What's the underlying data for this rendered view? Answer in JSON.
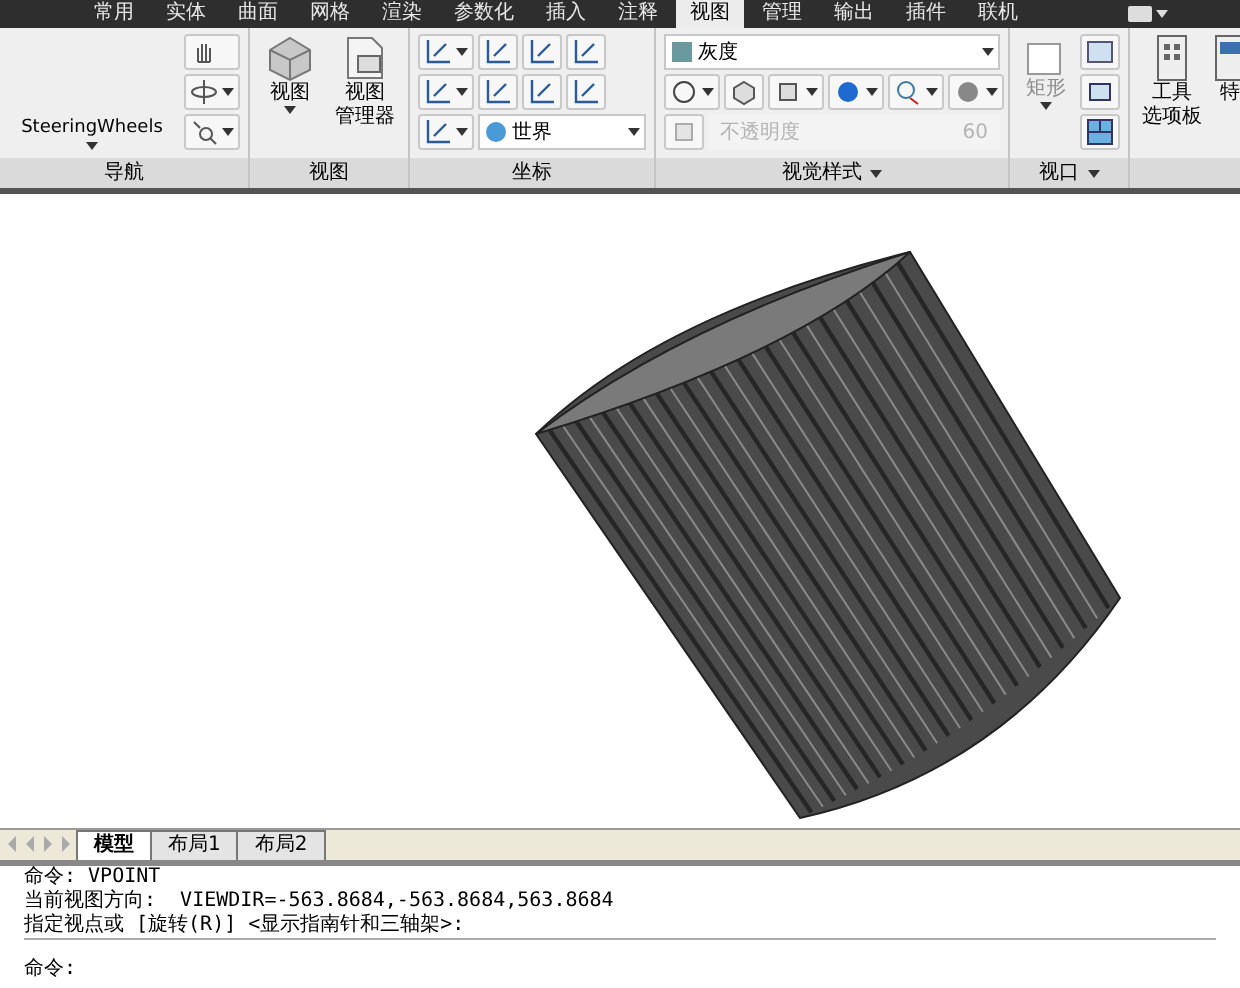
{
  "ribbon_tabs": [
    {
      "label": "常用",
      "selected": false
    },
    {
      "label": "实体",
      "selected": false
    },
    {
      "label": "曲面",
      "selected": false
    },
    {
      "label": "网格",
      "selected": false
    },
    {
      "label": "渲染",
      "selected": false
    },
    {
      "label": "参数化",
      "selected": false
    },
    {
      "label": "插入",
      "selected": false
    },
    {
      "label": "注释",
      "selected": false
    },
    {
      "label": "视图",
      "selected": true
    },
    {
      "label": "管理",
      "selected": false
    },
    {
      "label": "输出",
      "selected": false
    },
    {
      "label": "插件",
      "selected": false
    },
    {
      "label": "联机",
      "selected": false
    }
  ],
  "panels": {
    "navigation": {
      "title": "导航",
      "wheel_label": "SteeringWheels"
    },
    "view": {
      "title": "视图",
      "view_label": "视图",
      "manager_lines": [
        "视图",
        "管理器"
      ]
    },
    "ucs": {
      "title": "坐标",
      "ucs_value": "世界"
    },
    "visual_styles": {
      "title": "视觉样式",
      "style_value": "灰度",
      "opacity_placeholder": "不透明度",
      "opacity_value": "60",
      "opacity_disabled": true
    },
    "viewports": {
      "title": "视口",
      "rect_label": "矩形",
      "rect_disabled": true
    },
    "palettes": {
      "tool_lines": [
        "工具",
        "选项板"
      ],
      "cut_label": "特"
    }
  },
  "layout_tabs": [
    {
      "label": "模型",
      "selected": true
    },
    {
      "label": "布局1",
      "selected": false
    },
    {
      "label": "布局2",
      "selected": false
    }
  ],
  "command_lines": [
    "命令: VPOINT",
    "当前视图方向:  VIEWDIR=-563.8684,-563.8684,563.8684",
    "指定视点或 [旋转(R)] <显示指南针和三轴架>:"
  ],
  "command_prompt": "命令:"
}
